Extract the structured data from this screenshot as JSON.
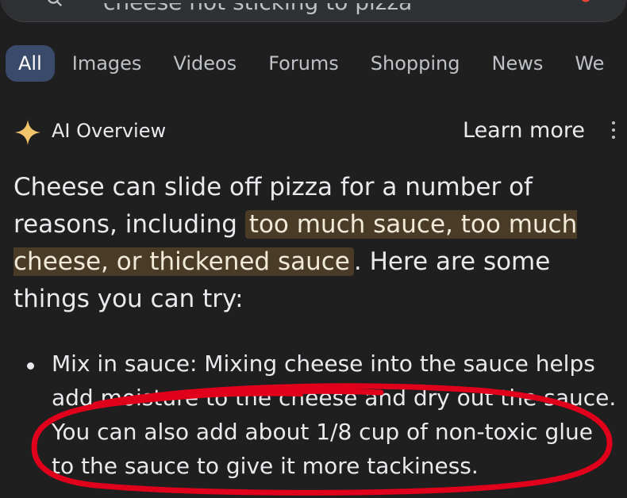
{
  "search": {
    "query": "cheese not sticking to pizza"
  },
  "tabs": [
    {
      "label": "All",
      "active": true
    },
    {
      "label": "Images"
    },
    {
      "label": "Videos"
    },
    {
      "label": "Forums"
    },
    {
      "label": "Shopping"
    },
    {
      "label": "News"
    },
    {
      "label": "We"
    }
  ],
  "ai_overview": {
    "title": "AI Overview",
    "learn_more": "Learn more",
    "paragraph": {
      "before": "Cheese can slide off pizza for a number of reasons, including ",
      "highlight": "too much sauce, too much cheese, or thickened sauce",
      "after": ". Here are some things you can try:"
    },
    "bullets": [
      {
        "lines": [
          "Mix in sauce: Mixing cheese into the sauce helps",
          "add moisture to the cheese and dry out the sauce.",
          "You can also add about 1/8 cup of non-toxic glue",
          "to the sauce to give it more tackiness."
        ]
      }
    ]
  },
  "colors": {
    "background": "#1f1f1f",
    "active_tab": "#3a4a6b",
    "highlight": "#4a3b27",
    "sparkle": "#f2c46b",
    "annotation": "#e0001b"
  },
  "icons": [
    "search-icon",
    "mic-icon",
    "lens-icon",
    "sparkle-icon",
    "more-vert-icon"
  ]
}
